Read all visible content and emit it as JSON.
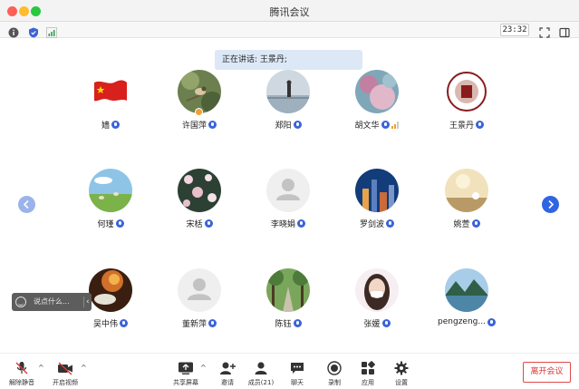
{
  "window": {
    "title": "腾讯会议"
  },
  "infobar": {
    "timer": "23:32"
  },
  "speaking": {
    "label": "正在讲话: 王景丹;"
  },
  "participants": [
    {
      "name": "嫱",
      "avatar": "flag"
    },
    {
      "name": "许国萍",
      "avatar": "bird",
      "host": true
    },
    {
      "name": "郑阳",
      "avatar": "person-lake"
    },
    {
      "name": "胡文华",
      "avatar": "flowers",
      "signal": true
    },
    {
      "name": "王景丹",
      "avatar": "university-seal",
      "avatar_text": "UNIVERSITY"
    },
    {
      "name": "何瑾",
      "avatar": "meadow"
    },
    {
      "name": "宋栝",
      "avatar": "blossom",
      "avatar_text": "Blooming Spring"
    },
    {
      "name": "李晓娟",
      "avatar": "default"
    },
    {
      "name": "罗剑波",
      "avatar": "city-night"
    },
    {
      "name": "姚萱",
      "avatar": "sunset-table"
    },
    {
      "name": "吴中伟",
      "avatar": "flower-fire"
    },
    {
      "name": "董新萍",
      "avatar": "default"
    },
    {
      "name": "陈钰",
      "avatar": "tree-road"
    },
    {
      "name": "张媛",
      "avatar": "girl-mask"
    },
    {
      "name": "pengzeng...",
      "avatar": "mountain-lake"
    }
  ],
  "chat": {
    "placeholder": "说点什么..."
  },
  "toolbar": {
    "unmute": "解除静音",
    "start_video": "开启视频",
    "share_screen": "共享屏幕",
    "invite": "邀请",
    "members": "成员(21)",
    "chat": "聊天",
    "record": "录制",
    "apps": "应用",
    "settings": "设置",
    "leave": "离开会议"
  },
  "colors": {
    "accent": "#2f65e2",
    "leave": "#d93636",
    "mute_badge": "#3a63d8"
  }
}
